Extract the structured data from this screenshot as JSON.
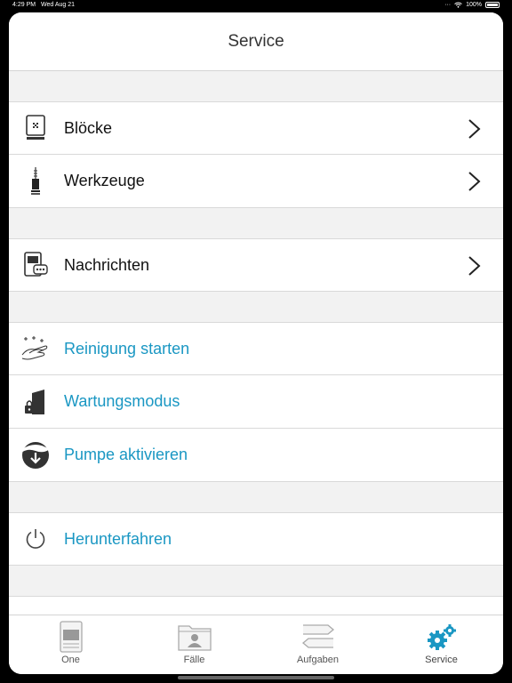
{
  "status_bar": {
    "time": "4:29 PM",
    "date": "Wed Aug 21",
    "battery": "100%"
  },
  "header": {
    "title": "Service"
  },
  "sections": [
    {
      "items": [
        {
          "label": "Blöcke",
          "icon": "blocks-icon",
          "type": "nav"
        },
        {
          "label": "Werkzeuge",
          "icon": "tool-icon",
          "type": "nav"
        }
      ]
    },
    {
      "items": [
        {
          "label": "Nachrichten",
          "icon": "messages-icon",
          "type": "nav"
        }
      ]
    },
    {
      "items": [
        {
          "label": "Reinigung starten",
          "icon": "cleaning-icon",
          "type": "action"
        },
        {
          "label": "Wartungsmodus",
          "icon": "maintenance-lock-icon",
          "type": "action"
        },
        {
          "label": "Pumpe aktivieren",
          "icon": "pump-icon",
          "type": "action"
        }
      ]
    },
    {
      "items": [
        {
          "label": "Herunterfahren",
          "icon": "power-icon",
          "type": "action"
        }
      ]
    }
  ],
  "tabbar": {
    "tabs": [
      {
        "label": "One",
        "icon": "device-icon"
      },
      {
        "label": "Fälle",
        "icon": "cases-folder-icon"
      },
      {
        "label": "Aufgaben",
        "icon": "tasks-arrows-icon"
      },
      {
        "label": "Service",
        "icon": "gears-icon",
        "active": true
      }
    ]
  },
  "colors": {
    "accent": "#1a97c3",
    "active_tab": "#1a97c3",
    "background": "#f2f2f2"
  }
}
